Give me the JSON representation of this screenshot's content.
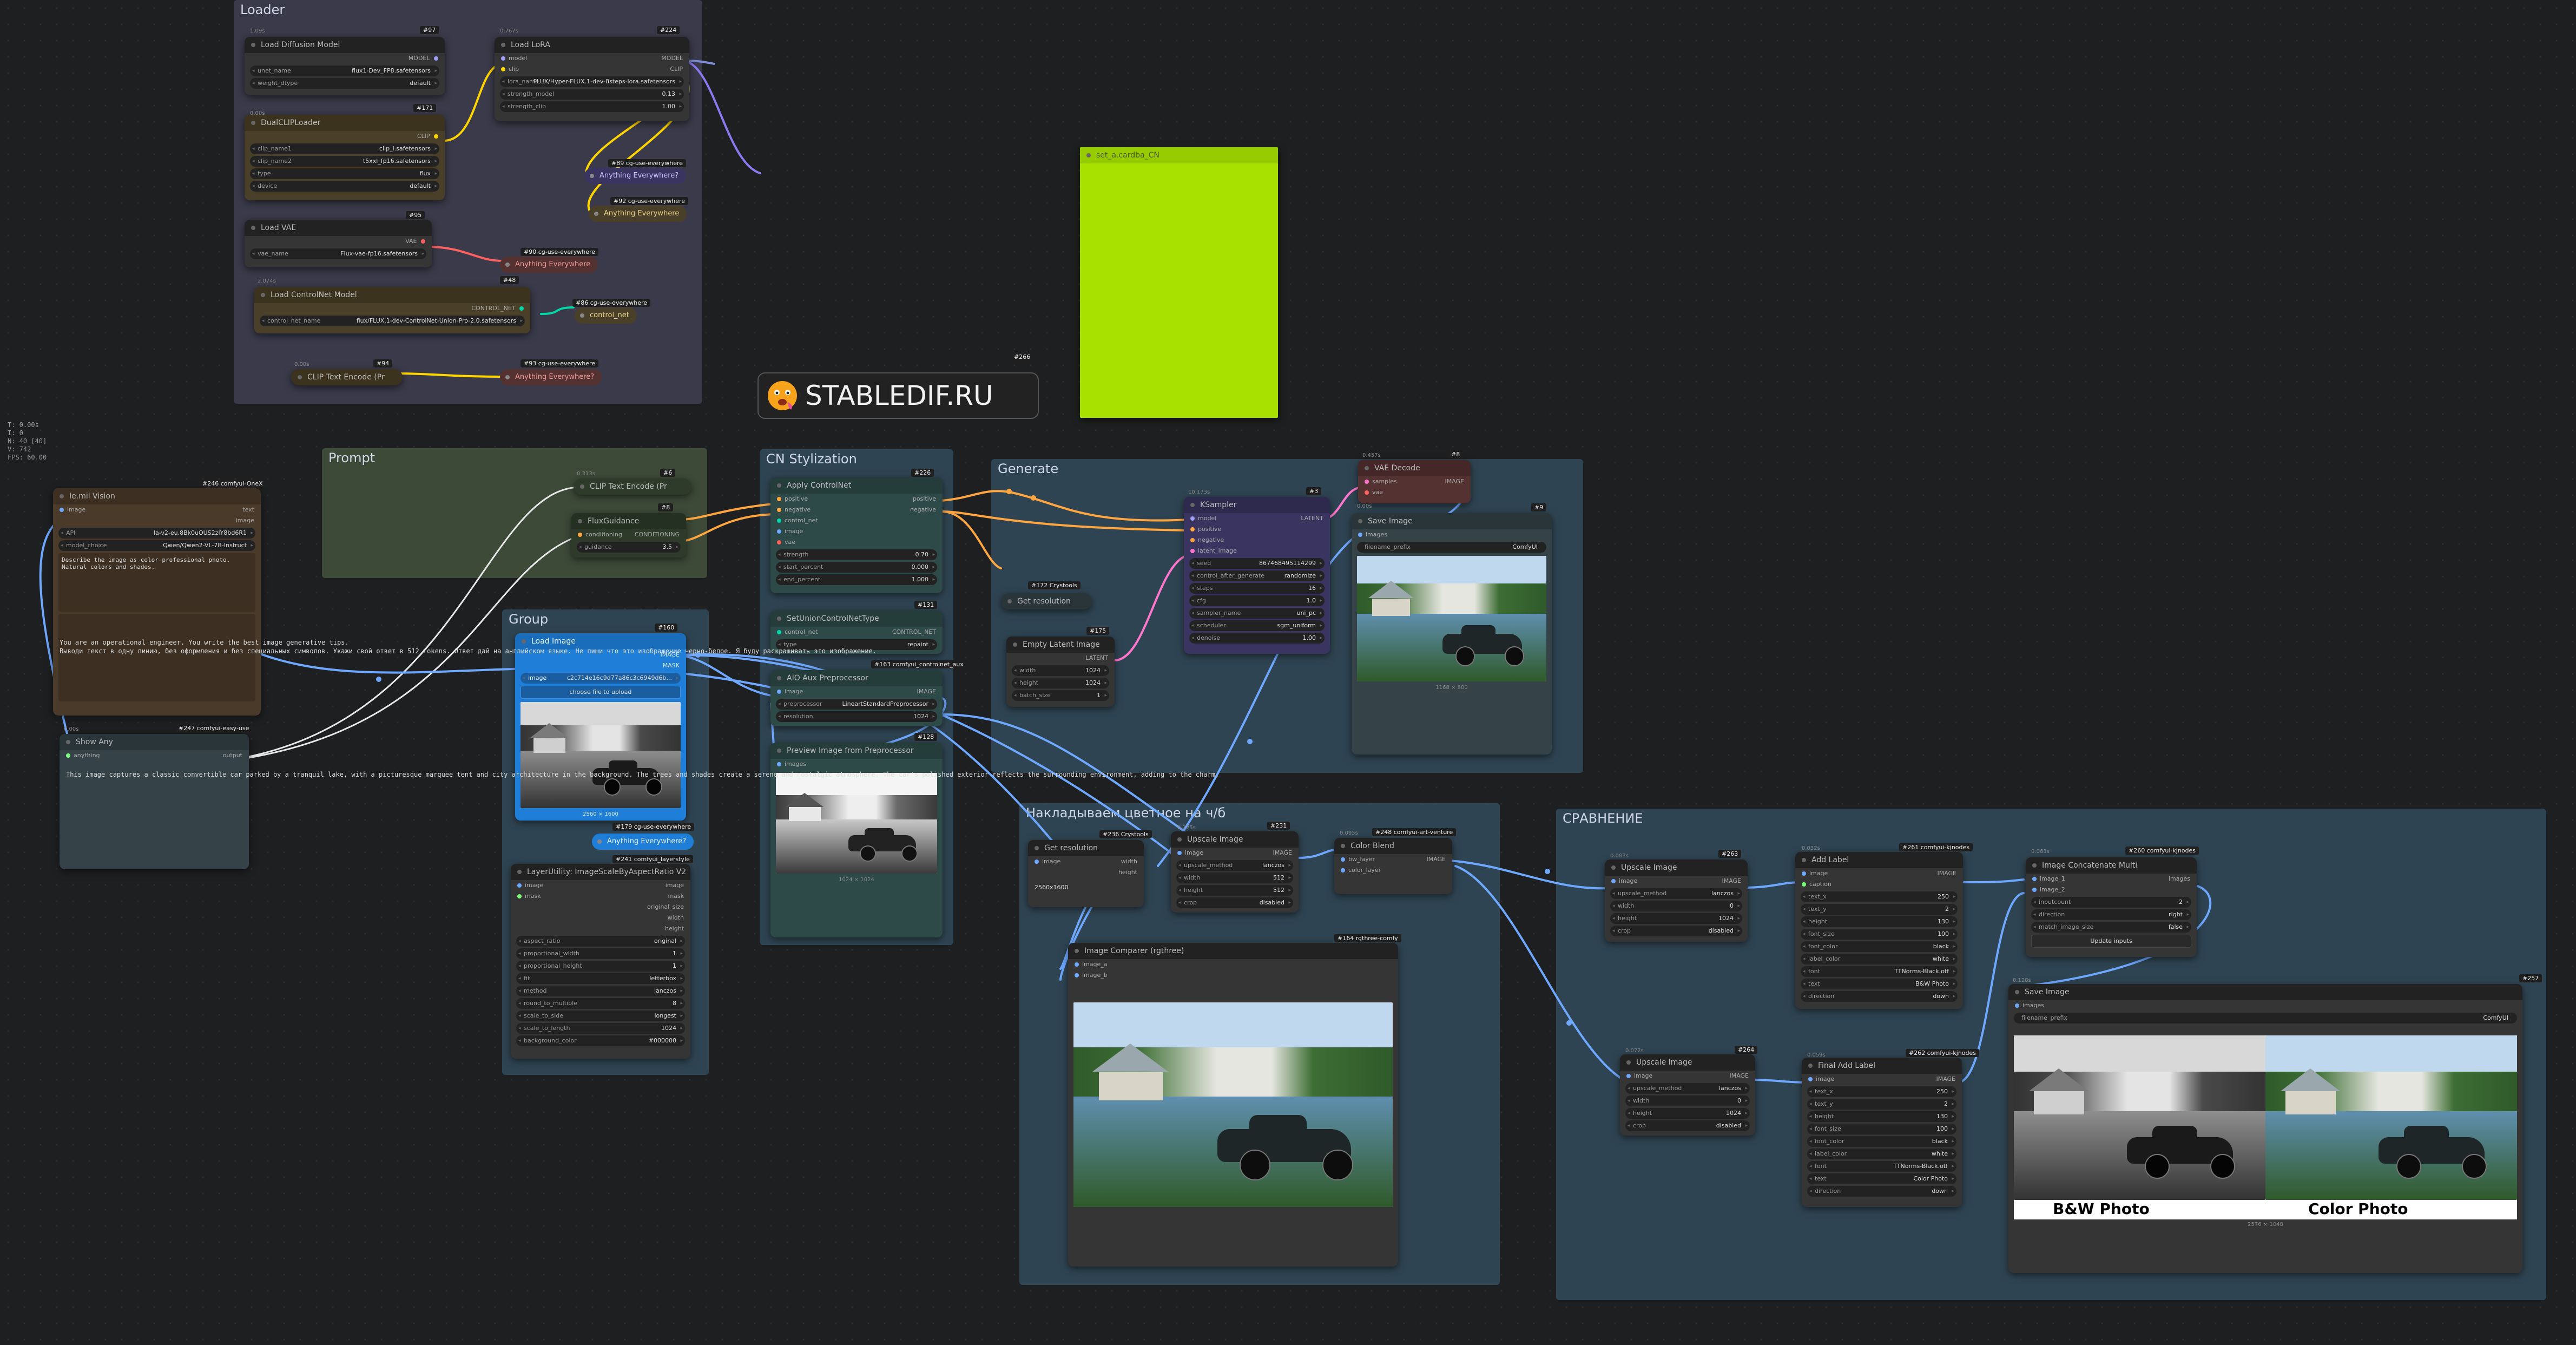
{
  "stats": [
    "T: 0.00s",
    "I: 0",
    "N: 40 [40]",
    "V: 742",
    "FPS: 60.00"
  ],
  "groups": {
    "loader": "Loader",
    "prompt": "Prompt",
    "cn": "CN Stylization",
    "generate": "Generate",
    "group": "Group",
    "overlay": "Накладываем цветное на ч/б",
    "compare": "СРАВНЕНИЕ"
  },
  "logo": {
    "text": "STABLEDIF.RU",
    "badge": "#266"
  },
  "loader": {
    "unet": {
      "id": "#97",
      "time": "1.09s",
      "title": "Load Diffusion Model",
      "out": "MODEL",
      "w1l": "unet_name",
      "w1v": "flux1-Dev_FP8.safetensors",
      "w2l": "weight_dtype",
      "w2v": "default"
    },
    "lora": {
      "id": "#224",
      "time": "0.767s",
      "title": "Load LoRA",
      "in1": "model",
      "in2": "clip",
      "out1": "MODEL",
      "out2": "CLIP",
      "w1l": "lora_name",
      "w1v": "FLUX/Hyper-FLUX.1-dev-8steps-lora.safetensors",
      "w2l": "strength_model",
      "w2v": "0.13",
      "w3l": "strength_clip",
      "w3v": "1.00"
    },
    "dualclip": {
      "id": "#171",
      "time": "0.00s",
      "title": "DualCLIPLoader",
      "out": "CLIP",
      "w1l": "clip_name1",
      "w1v": "clip_l.safetensors",
      "w2l": "clip_name2",
      "w2v": "t5xxl_fp16.safetensors",
      "w3l": "type",
      "w3v": "flux",
      "w4l": "device",
      "w4v": "default"
    },
    "vae": {
      "id": "#95",
      "time": "0.00s",
      "title": "Load VAE",
      "out": "VAE",
      "w1l": "vae_name",
      "w1v": "Flux-vae-fp16.safetensors"
    },
    "cnload": {
      "id": "#48",
      "time": "2.074s",
      "title": "Load ControlNet Model",
      "out": "CONTROL_NET",
      "w1l": "control_net_name",
      "w1v": "flux/FLUX.1-dev-ControlNet-Union-Pro-2.0.safetensors"
    },
    "clipenc": {
      "id": "#94",
      "time": "0.00s",
      "title": "CLIP Text Encode (Pr"
    },
    "ue1": {
      "id": "#89 cg-use-everywhere",
      "title": "Anything Everywhere?"
    },
    "ue2": {
      "id": "#92 cg-use-everywhere",
      "title": "Anything Everywhere"
    },
    "ue3": {
      "id": "#90 cg-use-everywhere",
      "title": "Anything Everywhere"
    },
    "ue4": {
      "id": "#86 cg-use-everywhere",
      "title": "control_net"
    },
    "ue5": {
      "id": "#93 cg-use-everywhere",
      "title": "Anything Everywhere?"
    }
  },
  "green_node": {
    "title": "set_a.cardba_CN"
  },
  "qwen": {
    "id": "#246 comfyui-OneX",
    "title": "Ie.mil Vision",
    "in": "image",
    "out1": "text",
    "out2": "image",
    "w1l": "API",
    "w1v": "la-v2-eu.8Bk0uOUS2zIY8bd6R1",
    "w2l": "model_choice",
    "w2v": "Qwen/Qwen2-VL-7B-Instruct",
    "prompt": "Describe the image as color professional photo.\nNatural colors and shades.",
    "sys": "You are an operational engineer. You write the best image generative tips.",
    "sys2": "Выводи текст в одну линию, без оформления и без специальных символов. Укажи свой ответ в 512 tokens. Ответ дай на английском языке. Не пиши что это изображение черно-белое. Я буду раскрашивать это изображение."
  },
  "showany": {
    "id": "#247 comfyui-easy-use",
    "time": "0.00s",
    "title": "Show Any",
    "in": "anything",
    "out": "output",
    "text": "This image captures a classic convertible car parked by a tranquil lake, with a picturesque marquee tent and city architecture in the background. The trees and shades create a serene and nostalgic atmosphere. The car's polished exterior reflects the surrounding environment, adding to the charm."
  },
  "prompt": {
    "clip": {
      "id": "#6",
      "time": "0.313s",
      "title": "CLIP Text Encode (Pr"
    },
    "flux": {
      "id": "#8",
      "title": "FluxGuidance",
      "in": "conditioning",
      "out": "CONDITIONING",
      "wl": "guidance",
      "wv": "3.5"
    }
  },
  "cn": {
    "apply": {
      "id": "#226",
      "title": "Apply ControlNet",
      "in1": "positive",
      "in2": "negative",
      "in3": "control_net",
      "in4": "image",
      "in5": "vae",
      "out1": "positive",
      "out2": "negative",
      "w1l": "strength",
      "w1v": "0.70",
      "w2l": "start_percent",
      "w2v": "0.000",
      "w3l": "end_percent",
      "w3v": "1.000"
    },
    "union": {
      "id": "#131",
      "title": "SetUnionControlNetType",
      "in": "control_net",
      "out": "CONTROL_NET",
      "wl": "type",
      "wv": "repaint"
    },
    "aio": {
      "id": "#163 comfyui_controlnet_aux",
      "title": "AIO Aux Preprocessor",
      "in": "image",
      "out": "IMAGE",
      "w1l": "preprocessor",
      "w1v": "LineartStandardPreprocessor",
      "w2l": "resolution",
      "w2v": "1024"
    },
    "preview": {
      "id": "#128",
      "title": "Preview Image from Preprocessor",
      "in": "images",
      "caption": "1024 × 1024"
    }
  },
  "gen": {
    "ksampler": {
      "id": "#3",
      "time": "10.173s",
      "title": "KSampler",
      "in1": "model",
      "in2": "positive",
      "in3": "negative",
      "in4": "latent_image",
      "out": "LATENT",
      "w1l": "seed",
      "w1v": "867468495114299",
      "w2l": "control_after_generate",
      "w2v": "randomize",
      "w3l": "steps",
      "w3v": "16",
      "w4l": "cfg",
      "w4v": "1.0",
      "w5l": "sampler_name",
      "w5v": "uni_pc",
      "w6l": "scheduler",
      "w6v": "sgm_uniform",
      "w7l": "denoise",
      "w7v": "1.00"
    },
    "vaedec": {
      "id": "#8",
      "time": "0.457s",
      "title": "VAE Decode",
      "in1": "samples",
      "in2": "vae",
      "out": "IMAGE"
    },
    "save": {
      "id": "#9",
      "time": "0.00s",
      "title": "Save Image",
      "in": "images",
      "wl": "filename_prefix",
      "wv": "ComfyUI",
      "caption": "1168 × 800"
    },
    "getres": {
      "id": "#172 Crystools",
      "title": "Get resolution"
    },
    "latent": {
      "id": "#175",
      "title": "Empty Latent Image",
      "out": "LATENT",
      "w1l": "width",
      "w1v": "1024",
      "w2l": "height",
      "w2v": "1024",
      "w3l": "batch_size",
      "w3v": "1"
    }
  },
  "grp": {
    "loadimg": {
      "id": "#160",
      "title": "Load Image",
      "out1": "IMAGE",
      "out2": "MASK",
      "wl": "image",
      "wv": "c2c714e16c9d77a86c3c6949d6b...",
      "btn": "choose file to upload",
      "caption": "2560 × 1600"
    },
    "ue": {
      "id": "#179 cg-use-everywhere",
      "title": "Anything Everywhere?"
    },
    "layer": {
      "id": "#241 comfyui_layerstyle",
      "title": "LayerUtility: ImageScaleByAspectRatio V2",
      "in1": "image",
      "in2": "mask",
      "out1": "image",
      "out2": "mask",
      "out3": "original_size",
      "out4": "width",
      "out5": "height",
      "rows": [
        [
          "aspect_ratio",
          "original"
        ],
        [
          "proportional_width",
          "1"
        ],
        [
          "proportional_height",
          "1"
        ],
        [
          "fit",
          "letterbox"
        ],
        [
          "method",
          "lanczos"
        ],
        [
          "round_to_multiple",
          "8"
        ],
        [
          "scale_to_side",
          "longest"
        ],
        [
          "scale_to_length",
          "1024"
        ],
        [
          "background_color",
          "#000000"
        ]
      ]
    }
  },
  "ov": {
    "getres": {
      "id": "#236 Crystools",
      "title": "Get resolution",
      "in": "image",
      "out1": "width",
      "out2": "height",
      "value": "2560x1600"
    },
    "upscale": {
      "id": "#231",
      "time": "0.125s",
      "title": "Upscale Image",
      "in": "image",
      "out": "IMAGE",
      "rows": [
        [
          "upscale_method",
          "lanczos"
        ],
        [
          "width",
          "512"
        ],
        [
          "height",
          "512"
        ],
        [
          "crop",
          "disabled"
        ]
      ]
    },
    "blend": {
      "id": "#248 comfyui-art-venture",
      "time": "0.095s",
      "title": "Color Blend",
      "in1": "bw_layer",
      "in2": "color_layer",
      "out": "IMAGE"
    },
    "compare": {
      "id": "#164 rgthree-comfy",
      "title": "Image Comparer (rgthree)",
      "in1": "image_a",
      "in2": "image_b"
    }
  },
  "cmp": {
    "up1": {
      "id": "#263",
      "time": "0.083s",
      "title": "Upscale Image",
      "in": "image",
      "out": "IMAGE",
      "rows": [
        [
          "upscale_method",
          "lanczos"
        ],
        [
          "width",
          "0"
        ],
        [
          "height",
          "1024"
        ],
        [
          "crop",
          "disabled"
        ]
      ]
    },
    "label1": {
      "id": "#261 comfyui-kjnodes",
      "time": "0.032s",
      "title": "Add Label",
      "in1": "image",
      "in2": "caption",
      "out": "IMAGE",
      "rows": [
        [
          "text_x",
          "250"
        ],
        [
          "text_y",
          "2"
        ],
        [
          "height",
          "130"
        ],
        [
          "font_size",
          "100"
        ],
        [
          "font_color",
          "black"
        ],
        [
          "label_color",
          "white"
        ],
        [
          "font",
          "TTNorms-Black.otf"
        ],
        [
          "text",
          "B&W Photo"
        ],
        [
          "direction",
          "down"
        ]
      ]
    },
    "concat": {
      "id": "#260 comfyui-kjnodes",
      "time": "0.063s",
      "title": "Image Concatenate Multi",
      "in1": "image_1",
      "in2": "image_2",
      "out": "images",
      "rows": [
        [
          "inputcount",
          "2"
        ],
        [
          "direction",
          "right"
        ],
        [
          "match_image_size",
          "false"
        ]
      ],
      "btn": "Update inputs"
    },
    "save": {
      "id": "#257",
      "time": "0.128s",
      "title": "Save Image",
      "in": "images",
      "wl": "filename_prefix",
      "wv": "ComfyUI",
      "label_bw": "B&W Photo",
      "label_color": "Color Photo",
      "caption": "2576 × 1048"
    },
    "up2": {
      "id": "#264",
      "time": "0.072s",
      "title": "Upscale Image",
      "in": "image",
      "out": "IMAGE",
      "rows": [
        [
          "upscale_method",
          "lanczos"
        ],
        [
          "width",
          "0"
        ],
        [
          "height",
          "1024"
        ],
        [
          "crop",
          "disabled"
        ]
      ]
    },
    "label2": {
      "id": "#262 comfyui-kjnodes",
      "time": "0.059s",
      "title": "Final Add Label",
      "in": "image",
      "out": "IMAGE",
      "rows": [
        [
          "text_x",
          "250"
        ],
        [
          "text_y",
          "2"
        ],
        [
          "height",
          "130"
        ],
        [
          "font_size",
          "100"
        ],
        [
          "font_color",
          "black"
        ],
        [
          "label_color",
          "white"
        ],
        [
          "font",
          "TTNorms-Black.otf"
        ],
        [
          "text",
          "Color Photo"
        ],
        [
          "direction",
          "down"
        ]
      ]
    }
  }
}
